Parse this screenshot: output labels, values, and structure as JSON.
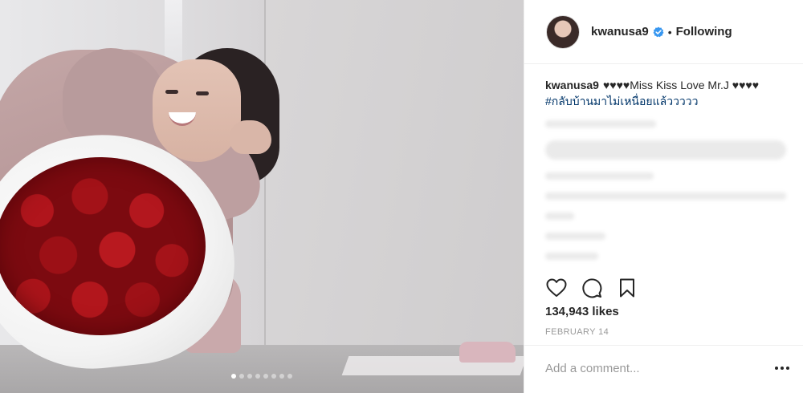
{
  "post": {
    "username": "kwanusa9",
    "verified": true,
    "follow_status": "Following",
    "bullet": "•",
    "caption": {
      "username": "kwanusa9",
      "text": "♥♥♥♥Miss Kiss Love Mr.J ♥♥♥♥ ",
      "hashtag": "#กลับบ้านมาไม่เหนื่อยแล้ววววว"
    },
    "likes": "134,943 likes",
    "date": "FEBRUARY 14",
    "carousel": {
      "total": 8,
      "active_index": 0
    }
  },
  "comment": {
    "placeholder": "Add a comment..."
  },
  "colors": {
    "verified_blue": "#3897f0",
    "hashtag": "#003569",
    "date_gray": "#999999",
    "divider": "#efefef"
  },
  "icons": [
    "heart-icon",
    "comment-icon",
    "bookmark-icon",
    "more-options-icon",
    "verified-badge-icon"
  ]
}
